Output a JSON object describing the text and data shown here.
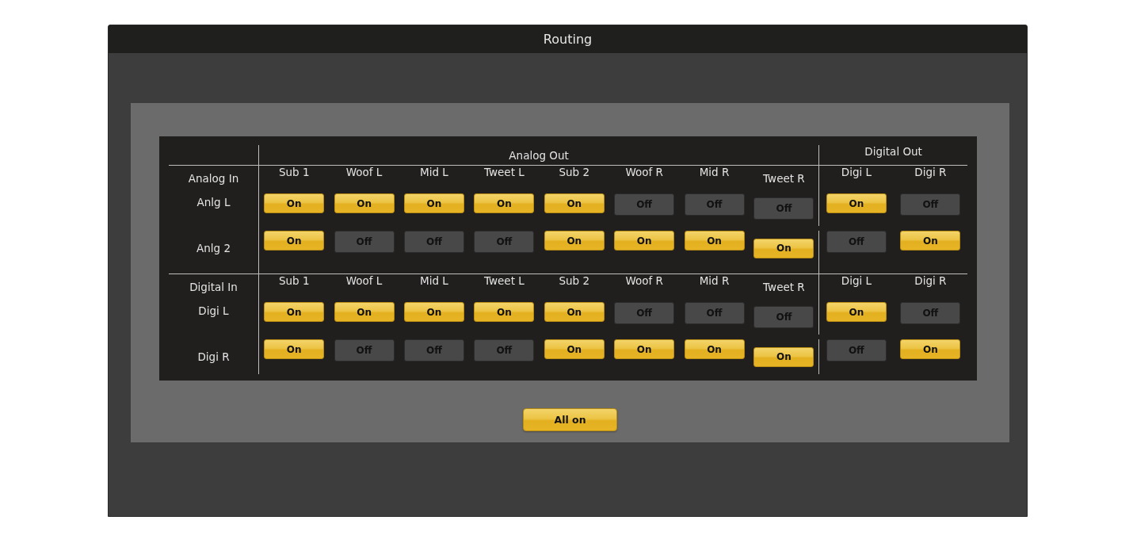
{
  "window": {
    "title": "Routing"
  },
  "groups": [
    {
      "label": "Analog Out"
    },
    {
      "label": "Digital Out"
    }
  ],
  "sections": [
    {
      "heading": "Analog In",
      "analog_columns": [
        "Sub 1",
        "Woof L",
        "Mid L",
        "Tweet L",
        "Sub 2",
        "Woof R",
        "Mid R",
        "Tweet R"
      ],
      "digital_columns": [
        "Digi L",
        "Digi R"
      ],
      "rows": [
        {
          "name": "Anlg L",
          "analog": [
            {
              "label": "On",
              "on": true
            },
            {
              "label": "On",
              "on": true
            },
            {
              "label": "On",
              "on": true
            },
            {
              "label": "On",
              "on": true
            },
            {
              "label": "On",
              "on": true
            },
            {
              "label": "Off",
              "on": false
            },
            {
              "label": "Off",
              "on": false
            },
            {
              "label": "Off",
              "on": false
            }
          ],
          "digital": [
            {
              "label": "On",
              "on": true
            },
            {
              "label": "Off",
              "on": false
            }
          ]
        },
        {
          "name": "Anlg 2",
          "analog": [
            {
              "label": "On",
              "on": true
            },
            {
              "label": "Off",
              "on": false
            },
            {
              "label": "Off",
              "on": false
            },
            {
              "label": "Off",
              "on": false
            },
            {
              "label": "On",
              "on": true
            },
            {
              "label": "On",
              "on": true
            },
            {
              "label": "On",
              "on": true
            },
            {
              "label": "On",
              "on": true
            }
          ],
          "digital": [
            {
              "label": "Off",
              "on": false
            },
            {
              "label": "On",
              "on": true
            }
          ]
        }
      ]
    },
    {
      "heading": "Digital In",
      "analog_columns": [
        "Sub 1",
        "Woof L",
        "Mid L",
        "Tweet L",
        "Sub 2",
        "Woof R",
        "Mid R",
        "Tweet R"
      ],
      "digital_columns": [
        "Digi L",
        "Digi R"
      ],
      "rows": [
        {
          "name": "Digi L",
          "analog": [
            {
              "label": "On",
              "on": true
            },
            {
              "label": "On",
              "on": true
            },
            {
              "label": "On",
              "on": true
            },
            {
              "label": "On",
              "on": true
            },
            {
              "label": "On",
              "on": true
            },
            {
              "label": "Off",
              "on": false
            },
            {
              "label": "Off",
              "on": false
            },
            {
              "label": "Off",
              "on": false
            }
          ],
          "digital": [
            {
              "label": "On",
              "on": true
            },
            {
              "label": "Off",
              "on": false
            }
          ]
        },
        {
          "name": "Digi R",
          "analog": [
            {
              "label": "On",
              "on": true
            },
            {
              "label": "Off",
              "on": false
            },
            {
              "label": "Off",
              "on": false
            },
            {
              "label": "Off",
              "on": false
            },
            {
              "label": "On",
              "on": true
            },
            {
              "label": "On",
              "on": true
            },
            {
              "label": "On",
              "on": true
            },
            {
              "label": "On",
              "on": true
            }
          ],
          "digital": [
            {
              "label": "Off",
              "on": false
            },
            {
              "label": "On",
              "on": true
            }
          ]
        }
      ]
    }
  ],
  "all_on_button": {
    "label": "All on"
  }
}
